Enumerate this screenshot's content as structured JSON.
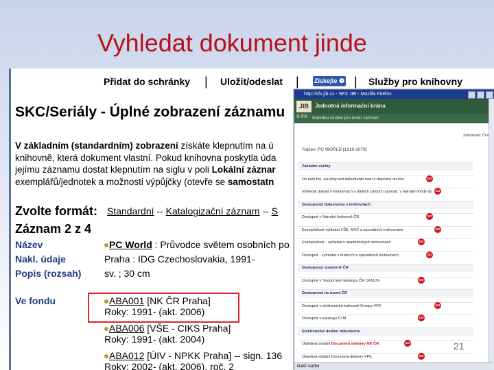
{
  "slide": {
    "title": "Vyhledat dokument jinde",
    "page_number": "21"
  },
  "toolbar": {
    "add_label": "Přidat do schránky",
    "save_label": "Uložit/odeslat",
    "getit_label": "Získejte ❺",
    "services_label": "Služby pro knihovny",
    "separator": "|"
  },
  "record": {
    "title": "SKC/Seriály - Úplné zobrazení záznamu",
    "intro_line1a": "V základním (standardním) zobrazení",
    "intro_line1b": " získáte klepnutím na ú",
    "intro_line2": "knihovně, která dokument vlastní. Pokud knihovna poskytla úda",
    "intro_line3a": "jejímu záznamu dostat klepnutím na siglu v poli ",
    "intro_line3b": "Lokální záznar",
    "intro_line4a": "exemplářů/jednotek a možnosti výpůjčky (otevře se ",
    "intro_line4b": "samostatn",
    "format_label": "Zvolte formát:",
    "format_standard": "Standardní",
    "format_sep": "--",
    "format_catalog": "Katalogizační záznam",
    "format_sep2": "--",
    "format_more": "S",
    "record_count": "Záznam 2 z 4",
    "fields": {
      "name_label": "Název",
      "name_value_link": "PC World",
      "name_value_rest": " : Průvodce světem osobních po",
      "imprint_label": "Nakl. údaje",
      "imprint_value": "Praha : IDG Czechoslovakia, 1991-",
      "extent_label": "Popis (rozsah)",
      "extent_value": "sv. ; 30 cm",
      "holdings_label": "Ve fondu"
    },
    "holdings": [
      {
        "sigla": "ABA001",
        "library": " [NK ČR Praha]",
        "years": "Roky: 1991- (akt. 2006)"
      },
      {
        "sigla": "ABA006",
        "library": " [VŠE - CIKS Praha]",
        "years": "Roky: 1991- (akt. 2004)"
      },
      {
        "sigla": "ABA012",
        "library": " [ÚIV - NPKK Praha] -- sign. 136",
        "years": "Roky: 2002- (akt. 2006), roč. 2"
      }
    ]
  },
  "popup": {
    "window_title": "http://sfx.jib.cz - SFX JIB - Mozilla Firefox",
    "jib_logo": "JIB",
    "banner_text": "Jednotná informační brána",
    "sfx_logo": "S·FX",
    "sfx_text": "Nabídka služeb pro tento záznam",
    "prefs_text": "Zobrazení: Česky",
    "page_title": "Název: PC WORLD [1210-1079]",
    "go_label": "GO",
    "rows": [
      {
        "text": "Základní služby",
        "section": true
      },
      {
        "text": "Do naší fce, ale plný text dokumentu není k dispozici on-line",
        "section": false
      },
      {
        "text": "Vyhledat doklad v knihovnách a dalších zdrojích (vybrat): v Národní fondy do",
        "section": false
      },
      {
        "text": "Dostupnost dokumentu v knihovnách",
        "section": true
      },
      {
        "text": "Dostupné v Národní knihovně ČR",
        "section": false
      },
      {
        "text": "Exemplářové vyhledat VŠE, MVČ a speciálních knihovnách",
        "section": false
      },
      {
        "text": "Exemplářové - vyhledat v akademických knihovnách",
        "section": false
      },
      {
        "text": "Dostupné - vyhledat v místních a speciálních knihovnách",
        "section": false
      },
      {
        "text": "Dostupnost souborně ČR",
        "section": true
      },
      {
        "text": "Dostupné v Souborném katalogu ČR CASLIN",
        "section": false
      },
      {
        "text": "Dostupnost na území ČR",
        "section": true
      },
      {
        "text": "Dostupné v elektronické knihovně Evropa VPK",
        "section": false
      },
      {
        "text": "Dostupné v katalogu STM",
        "section": false
      },
      {
        "text": "Elektronické dodání dokumentu",
        "section": true
      },
      {
        "text": "Objednat dodání ",
        "highlight": "Document delivery NK ČR",
        "section": false
      },
      {
        "text": "Objednat dodání Document delivery VPK",
        "section": false
      }
    ],
    "status_text": "Další služby"
  }
}
